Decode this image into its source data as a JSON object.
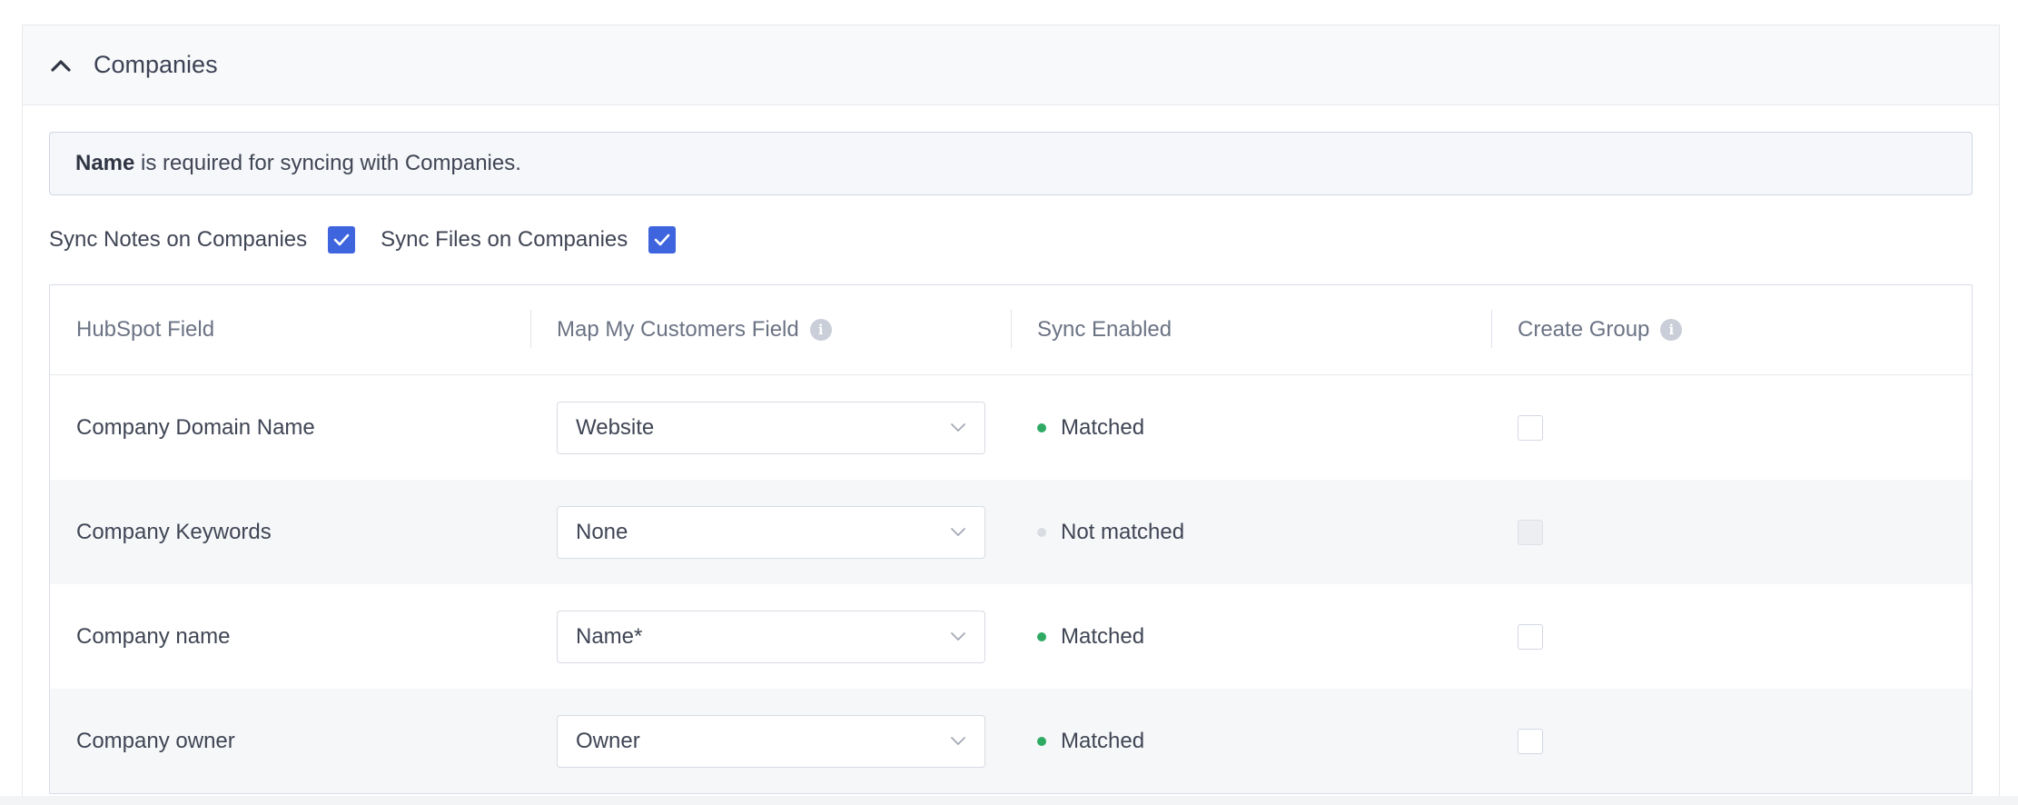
{
  "section": {
    "title": "Companies",
    "notice_bold": "Name",
    "notice_rest": " is required for syncing with Companies."
  },
  "options": {
    "sync_notes_label": "Sync Notes on Companies",
    "sync_notes_checked": true,
    "sync_files_label": "Sync Files on Companies",
    "sync_files_checked": true
  },
  "table": {
    "headers": {
      "hubspot_field": "HubSpot Field",
      "mmc_field": "Map My Customers Field",
      "sync_enabled": "Sync Enabled",
      "create_group": "Create Group"
    },
    "rows": [
      {
        "hubspot_field": "Company Domain Name",
        "mapped": "Website",
        "status": "Matched",
        "matched": true,
        "create_group_disabled": false
      },
      {
        "hubspot_field": "Company Keywords",
        "mapped": "None",
        "status": "Not matched",
        "matched": false,
        "create_group_disabled": true
      },
      {
        "hubspot_field": "Company name",
        "mapped": "Name*",
        "status": "Matched",
        "matched": true,
        "create_group_disabled": false
      },
      {
        "hubspot_field": "Company owner",
        "mapped": "Owner",
        "status": "Matched",
        "matched": true,
        "create_group_disabled": false
      }
    ]
  },
  "colors": {
    "accent": "#3e64de",
    "matched": "#2eaa63",
    "not_matched": "#d9dce2"
  },
  "icons": {
    "collapse": "chevron-up-icon",
    "info": "info-icon",
    "check": "checkmark-icon",
    "dropdown": "chevron-down-icon"
  }
}
